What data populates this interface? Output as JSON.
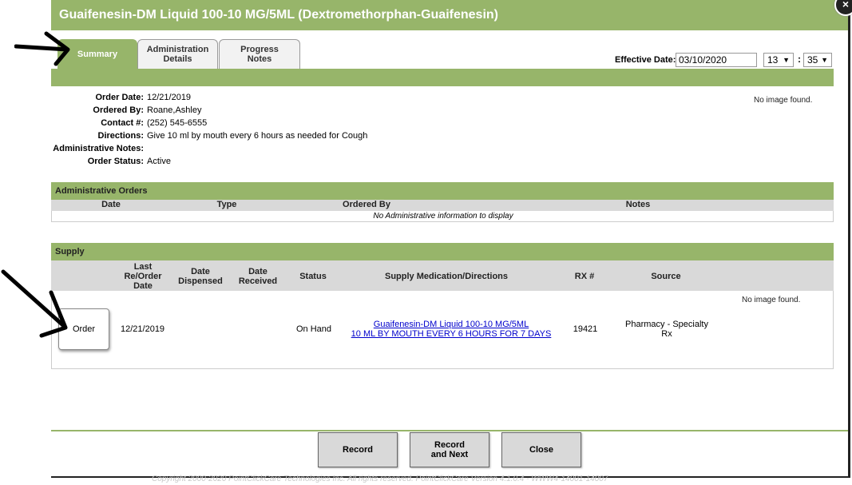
{
  "title": "Guaifenesin-DM Liquid 100-10 MG/5ML (Dextromethorphan-Guaifenesin)",
  "close_glyph": "×",
  "tabs": [
    {
      "label": "Summary"
    },
    {
      "label": "Administration Details"
    },
    {
      "label": "Progress Notes"
    }
  ],
  "effective": {
    "label": "Effective Date:",
    "date": "03/10/2020",
    "hour": "13",
    "minute": "35",
    "separator": ":"
  },
  "summary": {
    "rows": [
      {
        "label": "Order Date:",
        "value": "12/21/2019"
      },
      {
        "label": "Ordered By:",
        "value": "Roane,Ashley"
      },
      {
        "label": "Contact #:",
        "value": "(252) 545-6555"
      },
      {
        "label": "Directions:",
        "value": "Give 10 ml by mouth every 6 hours as needed for Cough"
      },
      {
        "label": "Administrative Notes:",
        "value": ""
      },
      {
        "label": "Order Status:",
        "value": "Active"
      }
    ],
    "no_image": "No image found."
  },
  "admin_orders": {
    "title": "Administrative Orders",
    "columns": [
      "Date",
      "Type",
      "Ordered By",
      "Notes"
    ],
    "empty_message": "No Administrative information to display"
  },
  "supply": {
    "title": "Supply",
    "columns": {
      "last_reorder": "Last Re/Order Date",
      "dispensed": "Date Dispensed",
      "received": "Date Received",
      "status": "Status",
      "medication": "Supply Medication/Directions",
      "rx": "RX #",
      "source": "Source"
    },
    "no_image": "No image found.",
    "row": {
      "order_button": "Order",
      "last_reorder": "12/21/2019",
      "dispensed": "",
      "received": "",
      "status": "On Hand",
      "medication_line1": "Guaifenesin-DM Liquid 100-10 MG/5ML",
      "medication_line2": "10 ML BY MOUTH EVERY 6 HOURS FOR 7 DAYS",
      "rx": "19421",
      "source": "Pharmacy - Specialty Rx"
    }
  },
  "footer": {
    "record": "Record",
    "record_next": "Record and Next",
    "close": "Close"
  },
  "copyright": "Copyright 2000-2020 PointClickCare Technologies Inc. All rights reserved.  PointClickCare Version 4.1.0.4 - WWW4-14001-14007",
  "colors": {
    "header_green": "#97b56a",
    "grid_gray": "#d9d9d9",
    "link_blue": "#0000cc"
  }
}
